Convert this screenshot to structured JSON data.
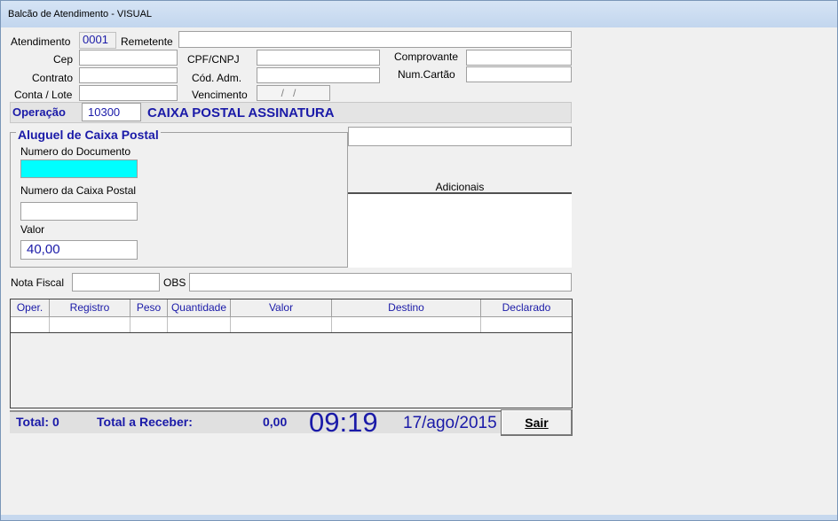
{
  "window": {
    "title": "Balcão de Atendimento - VISUAL"
  },
  "form": {
    "atendimento_label": "Atendimento",
    "atendimento_value": "0001",
    "remetente_label": "Remetente",
    "remetente_value": "",
    "cep_label": "Cep",
    "contrato_label": "Contrato",
    "conta_lote_label": "Conta / Lote",
    "cpf_cnpj_label": "CPF/CNPJ",
    "cod_adm_label": "Cód. Adm.",
    "vencimento_label": "Vencimento",
    "vencimento_value": "  /   /",
    "comprovante_label": "Comprovante",
    "num_cartao_label": "Num.Cartão"
  },
  "operation": {
    "label": "Operação",
    "code": "10300",
    "description": "CAIXA POSTAL ASSINATURA"
  },
  "group": {
    "title": "Aluguel de Caixa Postal",
    "doc_label": "Numero do Documento",
    "doc_value": "",
    "caixa_label": "Numero da Caixa Postal",
    "caixa_value": "",
    "valor_label": "Valor",
    "valor_value": "40,00"
  },
  "adicionais_label": "Adicionais",
  "nota_fiscal_label": "Nota Fiscal",
  "obs_label": "OBS",
  "grid": {
    "columns": [
      "Oper.",
      "Registro",
      "Peso",
      "Quantidade",
      "Valor",
      "Destino",
      "Declarado"
    ],
    "rows": []
  },
  "footer": {
    "total": "Total: 0",
    "total_receber_label": "Total a Receber:",
    "total_receber_value": "0,00",
    "time": "09:19",
    "date": "17/ago/2015"
  },
  "buttons": {
    "sair": "Sair"
  },
  "colors": {
    "label_blue": "#1a1aa8",
    "highlight_field": "#00ffff"
  }
}
